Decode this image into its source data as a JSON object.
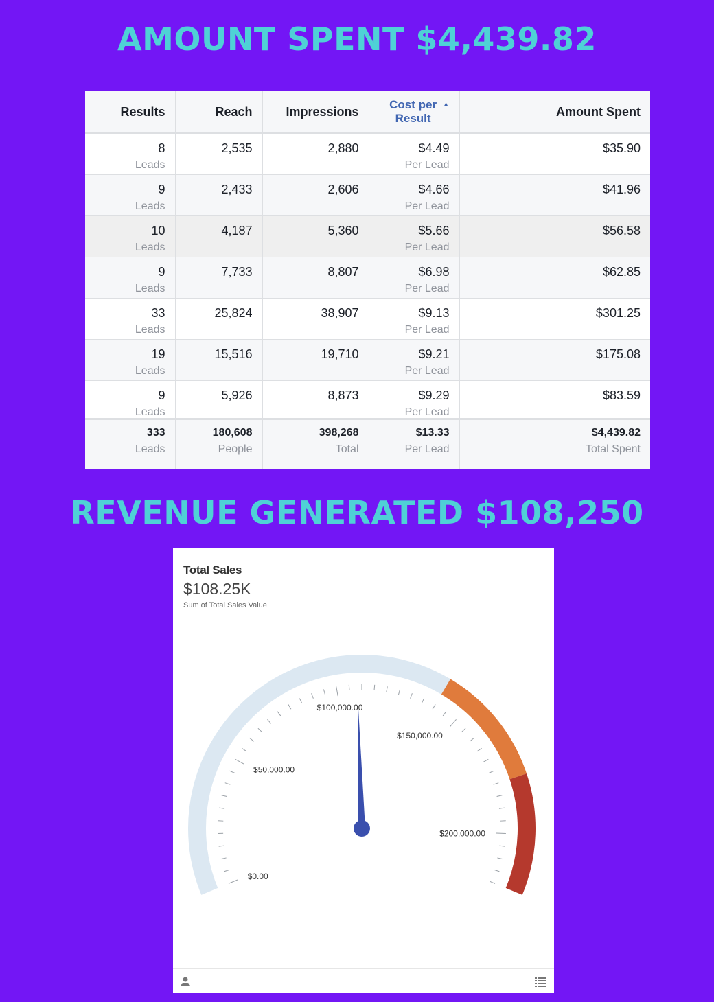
{
  "headline_spent": "AMOUNT SPENT $4,439.82",
  "headline_revenue": "REVENUE GENERATED $108,250",
  "table": {
    "columns": [
      "Results",
      "Reach",
      "Impressions",
      "Cost per Result",
      "Amount Spent"
    ],
    "sorted_column": "Cost per Result",
    "rows": [
      {
        "results": "8",
        "results_unit": "Leads",
        "reach": "2,535",
        "impressions": "2,880",
        "cost": "$4.49",
        "cost_unit": "Per Lead",
        "spent": "$35.90"
      },
      {
        "results": "9",
        "results_unit": "Leads",
        "reach": "2,433",
        "impressions": "2,606",
        "cost": "$4.66",
        "cost_unit": "Per Lead",
        "spent": "$41.96"
      },
      {
        "results": "10",
        "results_unit": "Leads",
        "reach": "4,187",
        "impressions": "5,360",
        "cost": "$5.66",
        "cost_unit": "Per Lead",
        "spent": "$56.58"
      },
      {
        "results": "9",
        "results_unit": "Leads",
        "reach": "7,733",
        "impressions": "8,807",
        "cost": "$6.98",
        "cost_unit": "Per Lead",
        "spent": "$62.85"
      },
      {
        "results": "33",
        "results_unit": "Leads",
        "reach": "25,824",
        "impressions": "38,907",
        "cost": "$9.13",
        "cost_unit": "Per Lead",
        "spent": "$301.25"
      },
      {
        "results": "19",
        "results_unit": "Leads",
        "reach": "15,516",
        "impressions": "19,710",
        "cost": "$9.21",
        "cost_unit": "Per Lead",
        "spent": "$175.08"
      },
      {
        "results": "9",
        "results_unit": "Leads",
        "reach": "5,926",
        "impressions": "8,873",
        "cost": "$9.29",
        "cost_unit": "Per Lead",
        "spent": "$83.59"
      }
    ],
    "totals": {
      "results": "333",
      "results_unit": "Leads",
      "reach": "180,608",
      "reach_unit": "People",
      "impressions": "398,268",
      "impressions_unit": "Total",
      "cost": "$13.33",
      "cost_unit": "Per Lead",
      "spent": "$4,439.82",
      "spent_unit": "Total Spent"
    }
  },
  "gauge_card": {
    "title": "Total Sales",
    "value": "$108.25K",
    "subtitle": "Sum of Total Sales Value",
    "footer_icons": [
      "user-icon",
      "list-icon"
    ]
  },
  "chart_data": {
    "type": "gauge",
    "value": 108250,
    "min": 0,
    "max": 220000,
    "tick_labels": [
      "$0.00",
      "$50,000.00",
      "$100,000.00",
      "$150,000.00",
      "$200,000.00"
    ],
    "tick_values": [
      0,
      50000,
      100000,
      150000,
      200000
    ],
    "bands": [
      {
        "from": 0,
        "to": 140000,
        "color": "#dce8f2"
      },
      {
        "from": 140000,
        "to": 180000,
        "color": "#e07b3c"
      },
      {
        "from": 180000,
        "to": 220000,
        "color": "#b5392d"
      }
    ],
    "needle_color": "#3a4fad"
  }
}
